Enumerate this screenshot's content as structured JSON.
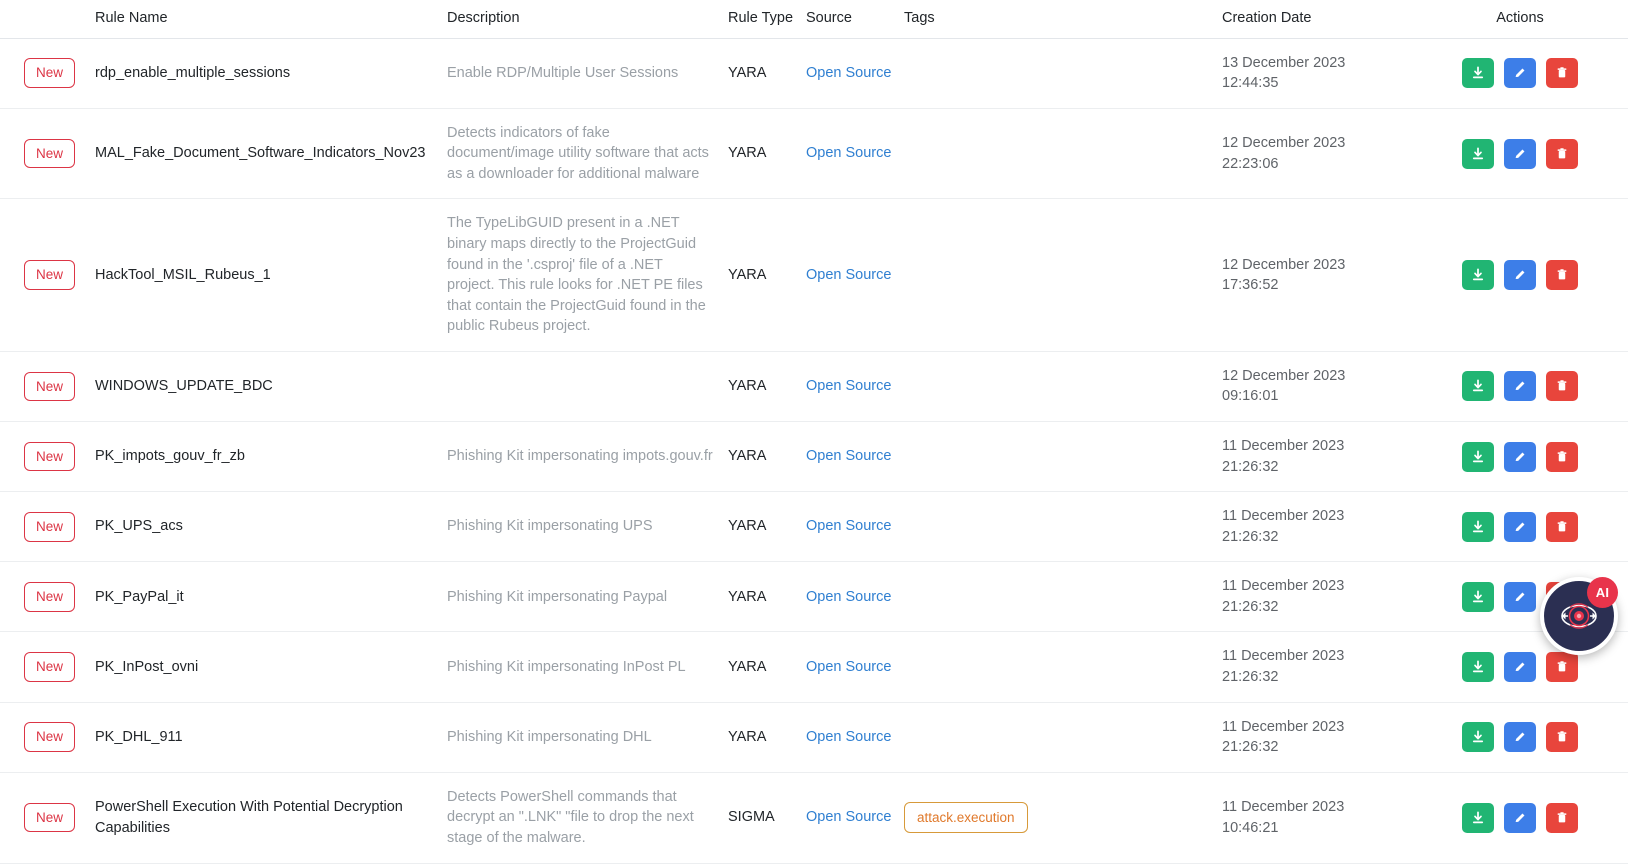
{
  "table": {
    "columns": [
      {
        "key": "badge",
        "label": ""
      },
      {
        "key": "name",
        "label": "Rule Name"
      },
      {
        "key": "desc",
        "label": "Description"
      },
      {
        "key": "type",
        "label": "Rule Type"
      },
      {
        "key": "source",
        "label": "Source"
      },
      {
        "key": "tags",
        "label": "Tags"
      },
      {
        "key": "date",
        "label": "Creation Date"
      },
      {
        "key": "actions",
        "label": "Actions"
      }
    ],
    "rows": [
      {
        "badge": "New",
        "name": "rdp_enable_multiple_sessions",
        "description": "Enable RDP/Multiple User Sessions",
        "rule_type": "YARA",
        "source": "Open Source",
        "tags": [],
        "date": "13 December 2023",
        "time": "12:44:35"
      },
      {
        "badge": "New",
        "name": "MAL_Fake_Document_Software_Indicators_Nov23",
        "description": "Detects indicators of fake document/image utility software that acts as a downloader for additional malware",
        "rule_type": "YARA",
        "source": "Open Source",
        "tags": [],
        "date": "12 December 2023",
        "time": "22:23:06"
      },
      {
        "badge": "New",
        "name": "HackTool_MSIL_Rubeus_1",
        "description": "The TypeLibGUID present in a .NET binary maps directly to the ProjectGuid found in the '.csproj' file of a .NET project. This rule looks for .NET PE files that contain the ProjectGuid found in the public Rubeus project.",
        "rule_type": "YARA",
        "source": "Open Source",
        "tags": [],
        "date": "12 December 2023",
        "time": "17:36:52"
      },
      {
        "badge": "New",
        "name": "WINDOWS_UPDATE_BDC",
        "description": "",
        "rule_type": "YARA",
        "source": "Open Source",
        "tags": [],
        "date": "12 December 2023",
        "time": "09:16:01"
      },
      {
        "badge": "New",
        "name": "PK_impots_gouv_fr_zb",
        "description": "Phishing Kit impersonating impots.gouv.fr",
        "rule_type": "YARA",
        "source": "Open Source",
        "tags": [],
        "date": "11 December 2023",
        "time": "21:26:32"
      },
      {
        "badge": "New",
        "name": "PK_UPS_acs",
        "description": "Phishing Kit impersonating UPS",
        "rule_type": "YARA",
        "source": "Open Source",
        "tags": [],
        "date": "11 December 2023",
        "time": "21:26:32"
      },
      {
        "badge": "New",
        "name": "PK_PayPal_it",
        "description": "Phishing Kit impersonating Paypal",
        "rule_type": "YARA",
        "source": "Open Source",
        "tags": [],
        "date": "11 December 2023",
        "time": "21:26:32"
      },
      {
        "badge": "New",
        "name": "PK_InPost_ovni",
        "description": "Phishing Kit impersonating InPost PL",
        "rule_type": "YARA",
        "source": "Open Source",
        "tags": [],
        "date": "11 December 2023",
        "time": "21:26:32"
      },
      {
        "badge": "New",
        "name": "PK_DHL_911",
        "description": "Phishing Kit impersonating DHL",
        "rule_type": "YARA",
        "source": "Open Source",
        "tags": [],
        "date": "11 December 2023",
        "time": "21:26:32"
      },
      {
        "badge": "New",
        "name": "PowerShell Execution With Potential Decryption Capabilities",
        "description": "Detects PowerShell commands that decrypt an \".LNK\" \"file to drop the next stage of the malware.",
        "rule_type": "SIGMA",
        "source": "Open Source",
        "tags": [
          "attack.execution"
        ],
        "date": "11 December 2023",
        "time": "10:46:21"
      }
    ],
    "actions": {
      "download": "download-icon",
      "edit": "edit-icon",
      "delete": "delete-icon"
    }
  },
  "ai_assistant": {
    "badge_label": "AI",
    "icon": "eye-icon"
  },
  "colors": {
    "badge_new_border": "#dc3545",
    "badge_new_text": "#dc3545",
    "tag_border": "#d79a3a",
    "tag_text": "#e0792b",
    "link": "#2f7fd1",
    "action_download": "#21b573",
    "action_edit": "#3d7ee8",
    "action_delete": "#e8453c",
    "ai_fab_bg": "#2b2f52",
    "ai_badge_bg": "#e8344b",
    "description_text": "#9aa0a6",
    "date_text": "#5f6368",
    "row_border": "#eceef0"
  }
}
